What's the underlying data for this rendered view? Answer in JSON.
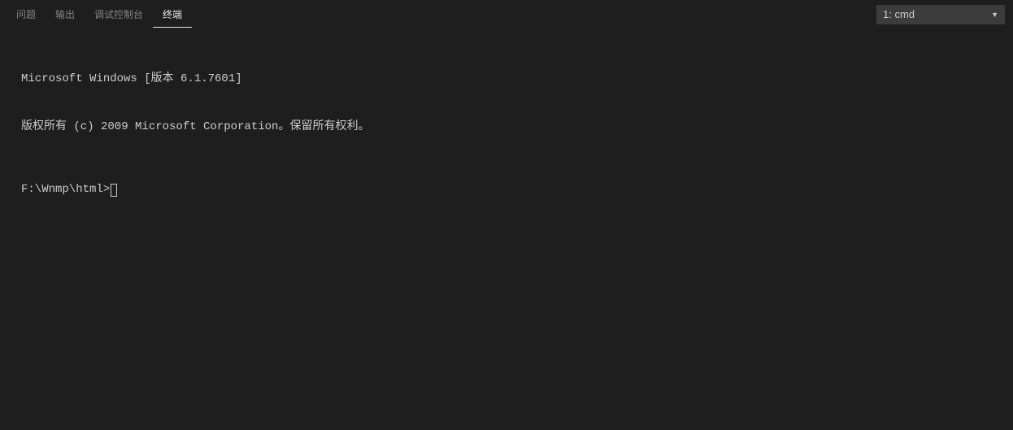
{
  "tabs": {
    "problems": "问题",
    "output": "输出",
    "debug_console": "调试控制台",
    "terminal": "终端"
  },
  "terminal_selector": {
    "selected": "1: cmd"
  },
  "terminal": {
    "line1": "Microsoft Windows [版本 6.1.7601]",
    "line2": "版权所有 (c) 2009 Microsoft Corporation。保留所有权利。",
    "prompt": "F:\\Wnmp\\html>"
  }
}
